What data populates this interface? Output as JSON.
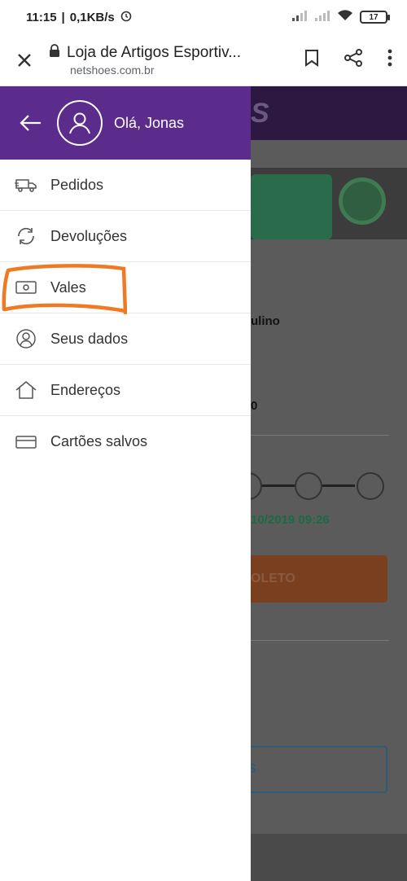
{
  "status_bar": {
    "time": "11:15",
    "speed": "0,1KB/s",
    "battery": "17",
    "icons": [
      "alarm-icon",
      "signal-icon",
      "wifi-icon",
      "battery-icon"
    ]
  },
  "browser": {
    "title": "Loja de Artigos Esportiv...",
    "url": "netshoes.com.br",
    "icons": [
      "close-icon",
      "lock-icon",
      "bookmark-icon",
      "share-icon",
      "more-icon"
    ]
  },
  "drawer": {
    "greeting": "Olá, Jonas",
    "accent_color": "#5c2c8c",
    "items": [
      {
        "label": "Pedidos",
        "icon": "truck-icon"
      },
      {
        "label": "Devoluções",
        "icon": "refresh-icon"
      },
      {
        "label": "Vales",
        "icon": "voucher-icon"
      },
      {
        "label": "Seus dados",
        "icon": "user-icon"
      },
      {
        "label": "Endereços",
        "icon": "home-icon"
      },
      {
        "label": "Cartões salvos",
        "icon": "card-icon"
      }
    ]
  },
  "background_page": {
    "partial_name": "ulino",
    "partial_number": "0",
    "date": "10/2019 09:26",
    "button_label": "OLETO",
    "outline_label": "S",
    "header_text": "S"
  },
  "annotation": {
    "color": "#f07a24"
  }
}
